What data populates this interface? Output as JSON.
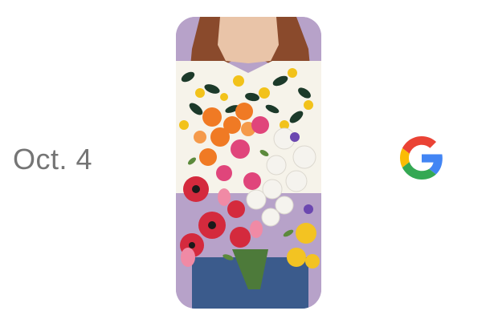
{
  "event": {
    "date_text": "Oct. 4"
  },
  "photo": {
    "subject": "person-holding-flower-bouquet"
  },
  "brand": {
    "logo_icon": "google-g-icon",
    "colors": {
      "blue": "#4285F4",
      "red": "#EA4335",
      "yellow": "#FBBC05",
      "green": "#34A853"
    }
  },
  "theme": {
    "background": "#ffffff",
    "date_text_color": "#757575"
  }
}
